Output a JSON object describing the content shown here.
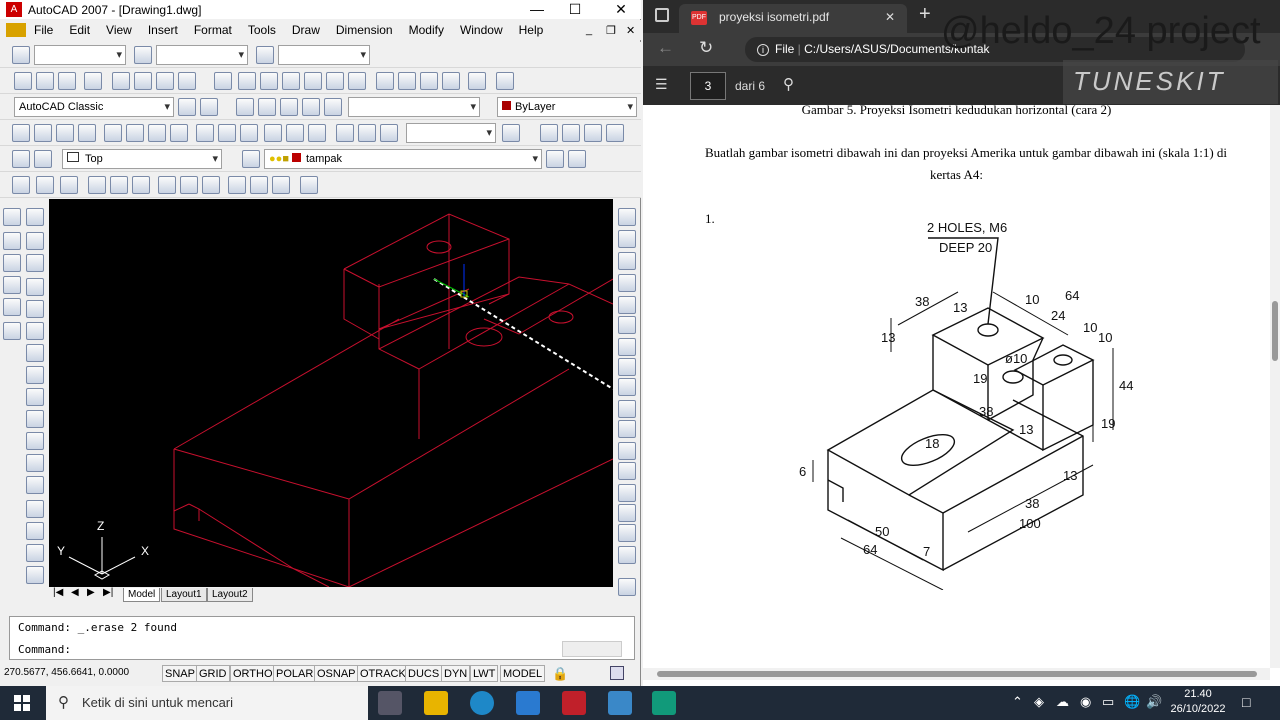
{
  "acad": {
    "title": "AutoCAD 2007 - [Drawing1.dwg]",
    "menu": [
      "File",
      "Edit",
      "View",
      "Insert",
      "Format",
      "Tools",
      "Draw",
      "Dimension",
      "Modify",
      "Window",
      "Help"
    ],
    "workspace": "AutoCAD Classic",
    "color_combo": "ByLayer",
    "view_combo": "Top",
    "layer_combo": "tampak",
    "ucs_labels": {
      "y": "Y",
      "x": "X",
      "z": "Z"
    },
    "tabs": [
      "Model",
      "Layout1",
      "Layout2"
    ],
    "command_lines": [
      "Command:  _.erase 2 found",
      "Command:"
    ],
    "coords": "270.5677, 456.6641, 0.0000",
    "status_toggles": [
      "SNAP",
      "GRID",
      "ORTHO",
      "POLAR",
      "OSNAP",
      "OTRACK",
      "DUCS",
      "DYN",
      "LWT",
      "MODEL"
    ],
    "colors": {
      "drawing_line": "#c8102e",
      "background": "#000000"
    }
  },
  "pdf": {
    "tab_title": "proyeksi isometri.pdf",
    "address_scheme": "File",
    "address": "C:/Users/ASUS/Documents/kontak",
    "page_current": "3",
    "page_total_label": "dari 6",
    "caption": "Gambar 5.  Proyeksi Isometri kedudukan horizontal (cara 2)",
    "instruction_line1": "Buatlah gambar isometri dibawah ini dan proyeksi Amerika untuk gambar dibawah ini (skala 1:1) di",
    "instruction_line2": "kertas A4:",
    "item_number": "1.",
    "drawing_note_line1": "2 HOLES, M6",
    "drawing_note_line2": "DEEP  20",
    "dims": [
      "38",
      "13",
      "10",
      "64",
      "24",
      "10",
      "10",
      "13",
      "ø10",
      "19",
      "38",
      "13",
      "44",
      "19",
      "18",
      "6",
      "13",
      "38",
      "100",
      "50",
      "64",
      "7"
    ]
  },
  "overlay": {
    "watermark": "@heldo_24 project",
    "logo": "TUNESKIT"
  },
  "taskbar": {
    "search_placeholder": "Ketik di sini untuk mencari",
    "time": "21.40",
    "date": "26/10/2022"
  }
}
